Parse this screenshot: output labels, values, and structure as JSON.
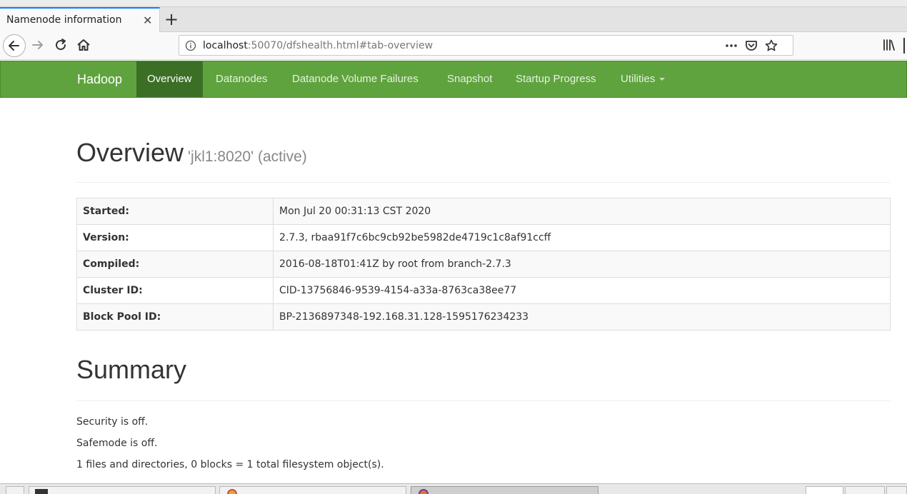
{
  "browser": {
    "tab_title": "Namenode information",
    "url_host": "localhost",
    "url_rest": ":50070/dfshealth.html#tab-overview"
  },
  "hadoop_nav": {
    "brand": "Hadoop",
    "items": [
      "Overview",
      "Datanodes",
      "Datanode Volume Failures",
      "Snapshot",
      "Startup Progress",
      "Utilities"
    ],
    "active": "Overview"
  },
  "overview": {
    "title": "Overview",
    "subtitle": "'jkl1:8020' (active)",
    "rows": [
      {
        "label": "Started:",
        "value": "Mon Jul 20 00:31:13 CST 2020"
      },
      {
        "label": "Version:",
        "value": "2.7.3, rbaa91f7c6bc9cb92be5982de4719c1c8af91ccff"
      },
      {
        "label": "Compiled:",
        "value": "2016-08-18T01:41Z by root from branch-2.7.3"
      },
      {
        "label": "Cluster ID:",
        "value": "CID-13756846-9539-4154-a33a-8763ca38ee77"
      },
      {
        "label": "Block Pool ID:",
        "value": "BP-2136897348-192.168.31.128-1595176234233"
      }
    ]
  },
  "summary": {
    "title": "Summary",
    "lines": [
      "Security is off.",
      "Safemode is off.",
      "1 files and directories, 0 blocks = 1 total filesystem object(s)."
    ]
  },
  "colors": {
    "hadoop_green": "#5fa33e",
    "hadoop_active": "#3b6f26"
  }
}
